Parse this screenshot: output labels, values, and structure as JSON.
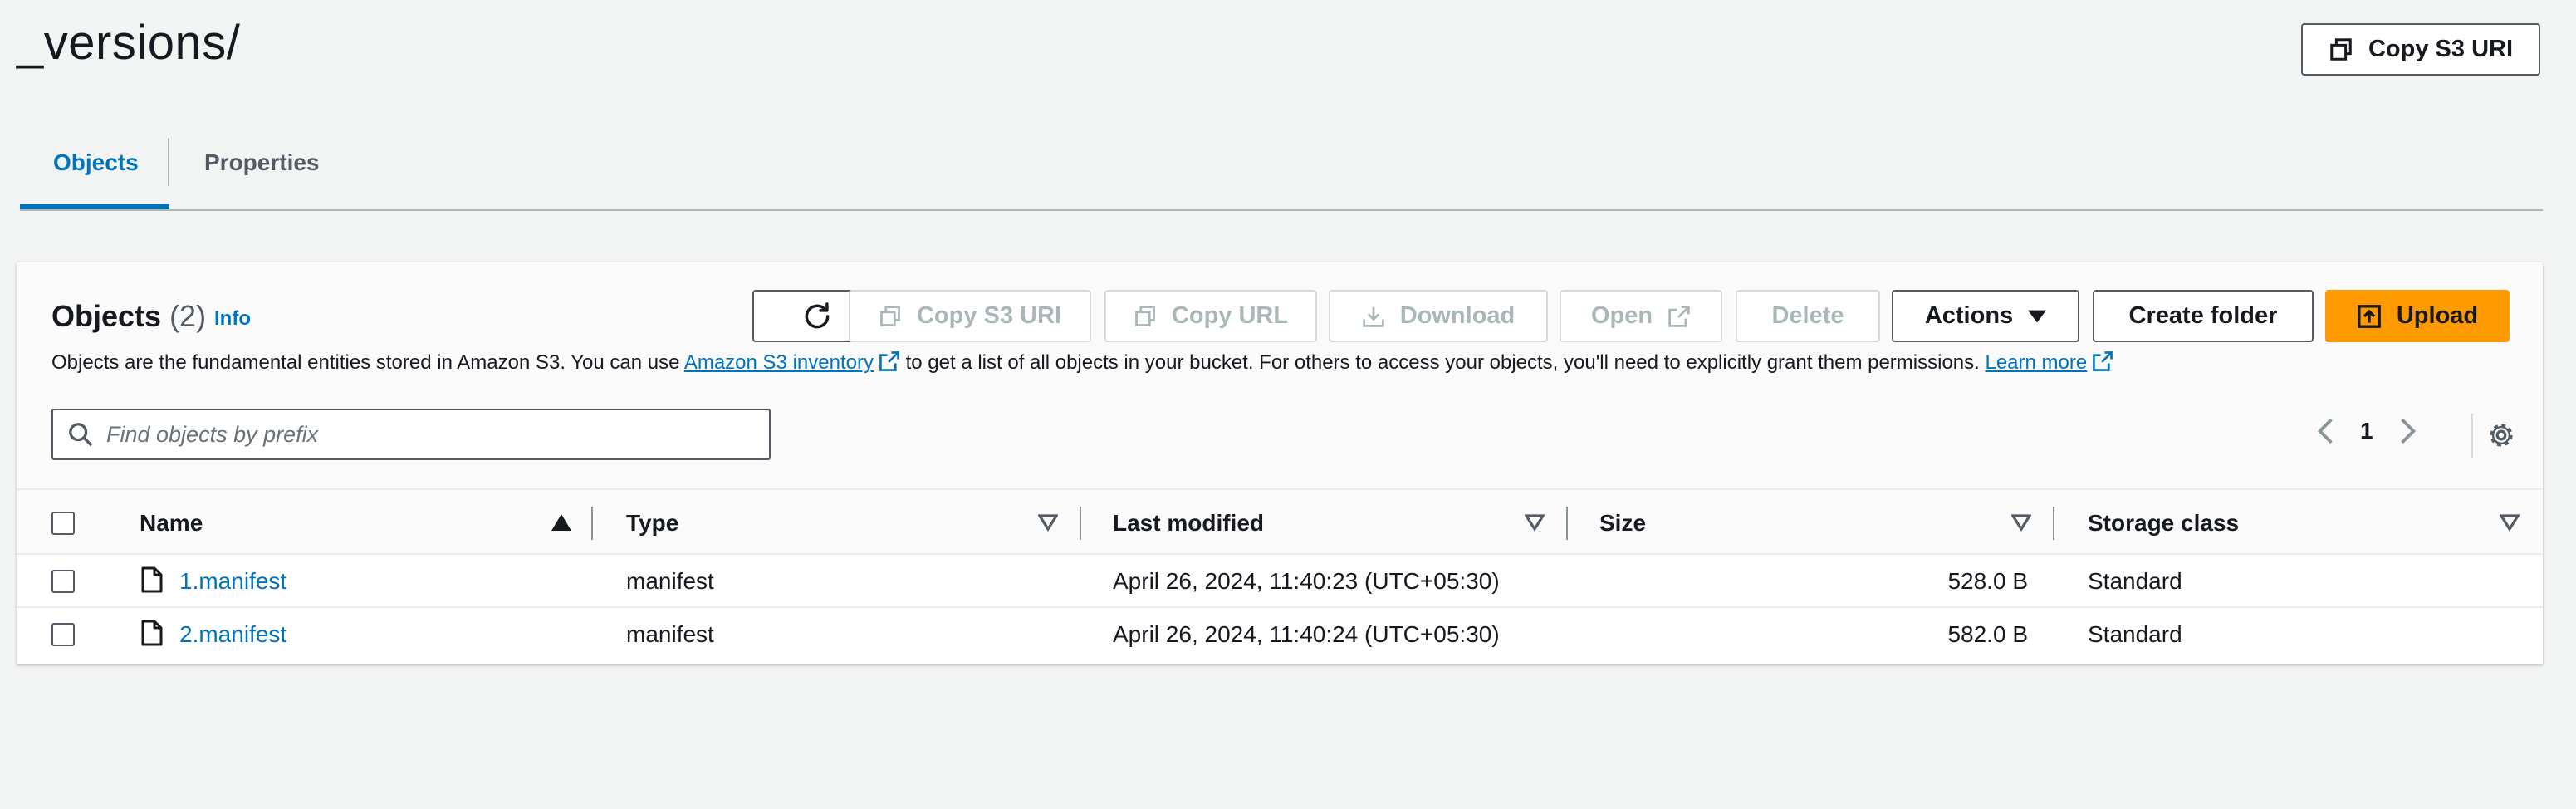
{
  "header": {
    "title": "_versions/",
    "copy_s3_uri": "Copy S3 URI"
  },
  "tabs": [
    {
      "label": "Objects",
      "active": true
    },
    {
      "label": "Properties",
      "active": false
    }
  ],
  "panel": {
    "title": "Objects",
    "count": "(2)",
    "info": "Info",
    "description_before": "Objects are the fundamental entities stored in Amazon S3. You can use ",
    "inventory_link": "Amazon S3 inventory",
    "description_middle": " to get a list of all objects in your bucket. For others to access your objects, you'll need to explicitly grant them permissions.",
    "learn_more": "Learn more"
  },
  "toolbar": {
    "copy_s3_uri": "Copy S3 URI",
    "copy_url": "Copy URL",
    "download": "Download",
    "open": "Open",
    "delete": "Delete",
    "actions": "Actions",
    "create_folder": "Create folder",
    "upload": "Upload"
  },
  "search": {
    "placeholder": "Find objects by prefix",
    "value": ""
  },
  "pagination": {
    "current_page": "1"
  },
  "table": {
    "columns": [
      "Name",
      "Type",
      "Last modified",
      "Size",
      "Storage class"
    ],
    "rows": [
      {
        "name": "1.manifest",
        "type": "manifest",
        "last_modified": "April 26, 2024, 11:40:23 (UTC+05:30)",
        "size": "528.0 B",
        "storage_class": "Standard"
      },
      {
        "name": "2.manifest",
        "type": "manifest",
        "last_modified": "April 26, 2024, 11:40:24 (UTC+05:30)",
        "size": "582.0 B",
        "storage_class": "Standard"
      }
    ]
  },
  "colors": {
    "accent": "#0073bb",
    "primary_button": "#ff9900",
    "disabled_text": "#aab7b8"
  },
  "icons": [
    "copy-icon",
    "refresh-icon",
    "download-icon",
    "external-link-icon",
    "caret-down-icon",
    "upload-icon",
    "search-icon",
    "chevron-left-icon",
    "chevron-right-icon",
    "gear-icon",
    "sort-ascending-icon",
    "sort-icon",
    "file-icon"
  ]
}
